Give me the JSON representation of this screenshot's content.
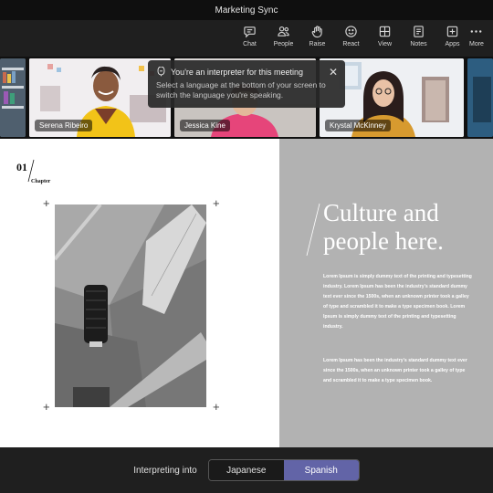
{
  "window": {
    "title": "Marketing Sync"
  },
  "toolbar": {
    "items": [
      {
        "label": "Chat",
        "icon": "chat-icon"
      },
      {
        "label": "People",
        "icon": "people-icon"
      },
      {
        "label": "Raise",
        "icon": "raise-hand-icon"
      },
      {
        "label": "React",
        "icon": "react-icon"
      },
      {
        "label": "View",
        "icon": "view-icon"
      },
      {
        "label": "Notes",
        "icon": "notes-icon"
      },
      {
        "label": "Apps",
        "icon": "apps-icon"
      },
      {
        "label": "More",
        "icon": "more-icon"
      }
    ]
  },
  "participants": [
    {
      "name": "Serena Ribeiro"
    },
    {
      "name": "Jessica Kine"
    },
    {
      "name": "Krystal McKinney"
    }
  ],
  "tooltip": {
    "title": "You're an interpreter for this meeting",
    "body": "Select a language at the bottom of your screen to switch the language you're speaking."
  },
  "slide": {
    "chapter_number": "01",
    "chapter_label": "Chapter",
    "headline": "Culture and people here.",
    "paragraph1": "Lorem Ipsum is simply dummy text of the printing and typesetting industry. Lorem Ipsum has been the industry's standard dummy text ever since the 1500s, when an unknown printer took a galley of type and scrambled it to make a type specimen book. Lorem Ipsum is simply dummy text of the printing and typesetting industry.",
    "paragraph2": "Lorem Ipsum has been the industry's standard dummy text ever since the 1500s, when an unknown printer took a galley of type and scrambled it to make a type specimen book."
  },
  "interpretation": {
    "label": "Interpreting into",
    "languages": [
      "Japanese",
      "Spanish"
    ],
    "selected": "Spanish"
  },
  "colors": {
    "accent": "#6264a7",
    "slide_panel": "#b2b2b2"
  }
}
